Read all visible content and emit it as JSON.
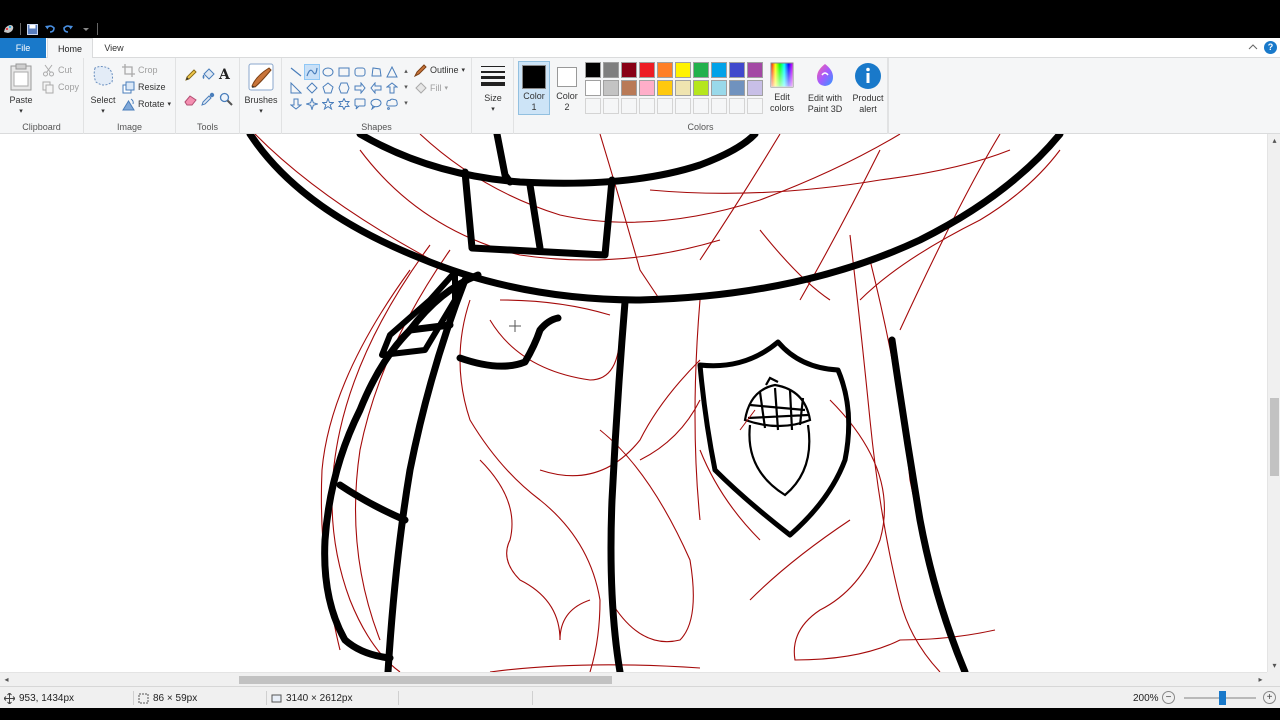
{
  "ribbon_tabs": {
    "file": "File",
    "home": "Home",
    "view": "View"
  },
  "help_glyph": "?",
  "clipboard": {
    "paste": "Paste",
    "cut": "Cut",
    "copy": "Copy",
    "group_label": "Clipboard"
  },
  "image": {
    "select": "Select",
    "crop": "Crop",
    "resize": "Resize",
    "rotate": "Rotate",
    "group_label": "Image"
  },
  "tools": {
    "group_label": "Tools"
  },
  "brushes": {
    "label": "Brushes"
  },
  "shapes": {
    "outline": "Outline",
    "fill": "Fill",
    "group_label": "Shapes"
  },
  "size": {
    "label": "Size"
  },
  "colors": {
    "color1_label": "Color\n1",
    "color2_label": "Color\n2",
    "color1": "#000000",
    "color2": "#ffffff",
    "edit_colors": "Edit\ncolors",
    "group_label": "Colors",
    "palette_row1": [
      "#000000",
      "#7f7f7f",
      "#880015",
      "#ed1c24",
      "#ff7f27",
      "#fff200",
      "#22b14c",
      "#00a2e8",
      "#3f48cc",
      "#a349a4"
    ],
    "palette_row2": [
      "#ffffff",
      "#c3c3c3",
      "#b97a57",
      "#ffaec9",
      "#ffc90e",
      "#efe4b0",
      "#b5e61d",
      "#99d9ea",
      "#7092be",
      "#c8bfe7"
    ]
  },
  "paint3d": {
    "label": "Edit with\nPaint 3D"
  },
  "product_alert": {
    "label": "Product\nalert"
  },
  "status": {
    "cursor_pos": "953, 1434px",
    "selection_size": "86 × 59px",
    "image_size": "3140 × 2612px",
    "zoom": "200%"
  },
  "accent_color": "#1979ca",
  "stroke_colors": {
    "ink": "#000000",
    "sketch": "#a50a0a"
  }
}
